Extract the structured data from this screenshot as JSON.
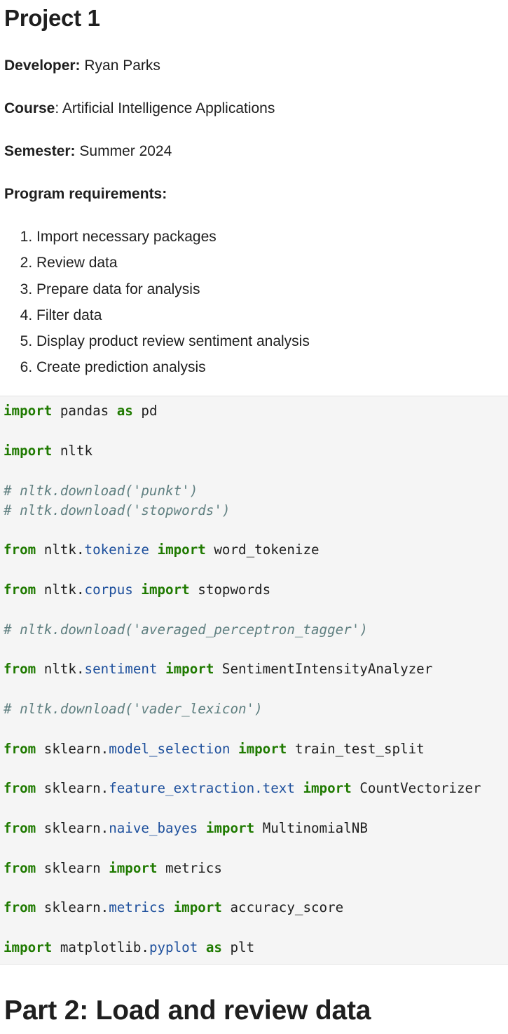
{
  "title": "Project 1",
  "developer": {
    "label": "Developer:",
    "value": " Ryan Parks"
  },
  "course": {
    "label": "Course",
    "value": ": Artificial Intelligence Applications"
  },
  "semester": {
    "label": "Semester:",
    "value": " Summer 2024"
  },
  "requirements_heading": "Program requirements:",
  "requirements": [
    "Import necessary packages",
    "Review data",
    "Prepare data for analysis",
    "Filter data",
    "Display product review sentiment analysis",
    "Create prediction analysis"
  ],
  "code_lines": [
    [
      [
        "kw",
        "import"
      ],
      [
        "t",
        " pandas "
      ],
      [
        "kw",
        "as"
      ],
      [
        "t",
        " pd"
      ]
    ],
    [
      [
        "kw",
        "import"
      ],
      [
        "t",
        " nltk"
      ]
    ],
    [
      [
        "cm",
        "# nltk.download('punkt')"
      ]
    ],
    [
      [
        "cm",
        "# nltk.download('stopwords')"
      ]
    ],
    [
      [
        "kw",
        "from"
      ],
      [
        "t",
        " nltk."
      ],
      [
        "mod",
        "tokenize"
      ],
      [
        "t",
        " "
      ],
      [
        "kw",
        "import"
      ],
      [
        "t",
        " word_tokenize"
      ]
    ],
    [
      [
        "kw",
        "from"
      ],
      [
        "t",
        " nltk."
      ],
      [
        "mod",
        "corpus"
      ],
      [
        "t",
        " "
      ],
      [
        "kw",
        "import"
      ],
      [
        "t",
        " stopwords"
      ]
    ],
    [
      [
        "cm",
        "# nltk.download('averaged_perceptron_tagger')"
      ]
    ],
    [
      [
        "kw",
        "from"
      ],
      [
        "t",
        " nltk."
      ],
      [
        "mod",
        "sentiment"
      ],
      [
        "t",
        " "
      ],
      [
        "kw",
        "import"
      ],
      [
        "t",
        " SentimentIntensityAnalyzer"
      ]
    ],
    [
      [
        "cm",
        "# nltk.download('vader_lexicon')"
      ]
    ],
    [
      [
        "kw",
        "from"
      ],
      [
        "t",
        " sklearn."
      ],
      [
        "mod",
        "model_selection"
      ],
      [
        "t",
        " "
      ],
      [
        "kw",
        "import"
      ],
      [
        "t",
        " train_test_split"
      ]
    ],
    [
      [
        "kw",
        "from"
      ],
      [
        "t",
        " sklearn."
      ],
      [
        "mod",
        "feature_extraction.text"
      ],
      [
        "t",
        " "
      ],
      [
        "kw",
        "import"
      ],
      [
        "t",
        " CountVectorizer"
      ]
    ],
    [
      [
        "kw",
        "from"
      ],
      [
        "t",
        " sklearn."
      ],
      [
        "mod",
        "naive_bayes"
      ],
      [
        "t",
        " "
      ],
      [
        "kw",
        "import"
      ],
      [
        "t",
        " MultinomialNB"
      ]
    ],
    [
      [
        "kw",
        "from"
      ],
      [
        "t",
        " sklearn "
      ],
      [
        "kw",
        "import"
      ],
      [
        "t",
        " metrics"
      ]
    ],
    [
      [
        "kw",
        "from"
      ],
      [
        "t",
        " sklearn."
      ],
      [
        "mod",
        "metrics"
      ],
      [
        "t",
        " "
      ],
      [
        "kw",
        "import"
      ],
      [
        "t",
        " accuracy_score"
      ]
    ],
    [
      [
        "kw",
        "import"
      ],
      [
        "t",
        " matplotlib."
      ],
      [
        "mod",
        "pyplot"
      ],
      [
        "t",
        " "
      ],
      [
        "kw",
        "as"
      ],
      [
        "t",
        " plt"
      ]
    ]
  ],
  "part2_heading": "Part 2: Load and review data",
  "colors": {
    "keyword": "#1f7a00",
    "module": "#1d4f9c",
    "comment": "#5f7f80",
    "code_bg": "#f5f5f5"
  }
}
